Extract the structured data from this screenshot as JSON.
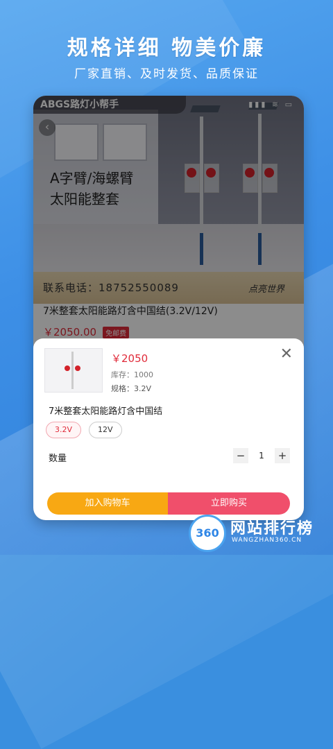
{
  "promo": {
    "headline": "规格详细 物美价廉",
    "subline": "厂家直销、及时发货、品质保证"
  },
  "app": {
    "brand": "ABGS路灯小帮手",
    "status_icons": "▮▮▮ ≋ ▭"
  },
  "hero": {
    "line1": "A字臂/海螺臂",
    "line2": "太阳能整套",
    "contact": "联系电话：18752550089",
    "signature": "点亮世界"
  },
  "product": {
    "title": "7米整套太阳能路灯含中国结(3.2V/12V)",
    "price": "￥2050.00",
    "free_shipping": "免邮费"
  },
  "sheet": {
    "price": "￥2050",
    "stock": "库存：1000",
    "spec": "规格：3.2V",
    "name": "7米整套太阳能路灯含中国结",
    "options": [
      "3.2V",
      "12V"
    ],
    "qty_label": "数量",
    "qty_minus": "−",
    "qty_value": "1",
    "qty_plus": "+",
    "close": "✕",
    "add_cart": "加入购物车",
    "buy_now": "立即购买"
  },
  "watermark": {
    "logo": "360",
    "name": "网站排行榜",
    "url": "WANGZHAN360.CN"
  },
  "colors": {
    "accent_red": "#e02b3a",
    "cart_orange": "#f8a813",
    "buy_pink": "#f04f6b",
    "bg_blue": "#3d8fe6"
  }
}
